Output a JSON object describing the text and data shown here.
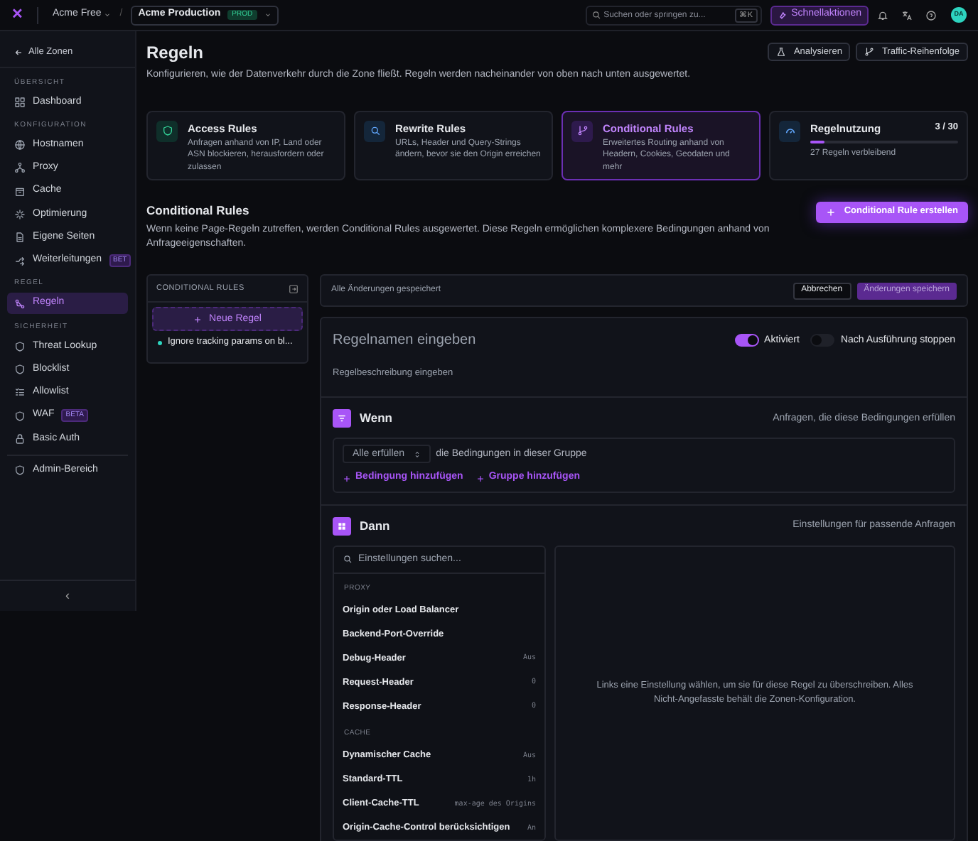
{
  "topbar": {
    "logo": "✕",
    "account": "Acme Free",
    "separator": "/",
    "zone": "Acme Production",
    "zone_badge": "PROD",
    "search": {
      "placeholder": "Suchen oder springen zu..."
    },
    "shortcut": "⌘K",
    "quick_actions": "Schnellaktionen",
    "avatar": "DA"
  },
  "sidebar": {
    "back": "Alle Zonen",
    "sections": [
      {
        "title": "ÜBERSICHT",
        "items": [
          {
            "label": "Dashboard",
            "selected": false
          }
        ]
      },
      {
        "title": "KONFIGURATION",
        "items": [
          {
            "label": "Hostnamen",
            "selected": false
          },
          {
            "label": "Proxy",
            "selected": false
          },
          {
            "label": "Cache",
            "selected": false
          },
          {
            "label": "Optimierung",
            "selected": false
          },
          {
            "label": "Eigene Seiten",
            "selected": false
          },
          {
            "label": "Weiterleitungen",
            "badge": "BET",
            "selected": false
          }
        ]
      },
      {
        "title": "REGEL",
        "items": [
          {
            "label": "Regeln",
            "selected": true
          }
        ]
      },
      {
        "title": "SICHERHEIT",
        "items": [
          {
            "label": "Threat Lookup",
            "selected": false
          },
          {
            "label": "Blocklist",
            "selected": false
          },
          {
            "label": "Allowlist",
            "selected": false
          },
          {
            "label": "WAF",
            "badge": "BETA",
            "selected": false
          },
          {
            "label": "Basic Auth",
            "selected": false
          }
        ]
      }
    ],
    "footer_items": [
      {
        "label": "Admin-Bereich",
        "selected": false
      }
    ],
    "collapse": "‹"
  },
  "page": {
    "title": "Regeln",
    "subtitle": "Konfigurieren, wie der Datenverkehr durch die Zone fließt. Regeln werden nacheinander von oben nach unten ausgewertet.",
    "actions": [
      {
        "label": "Analysieren"
      },
      {
        "label": "Traffic-Reihenfolge"
      }
    ]
  },
  "rule_types": [
    {
      "title": "Access Rules",
      "description": "Anfragen anhand von IP, Land oder ASN blockieren, herausfordern oder zulassen",
      "selected": false
    },
    {
      "title": "Rewrite Rules",
      "description": "URLs, Header und Query-Strings ändern, bevor sie den Origin erreichen",
      "selected": false
    },
    {
      "title": "Conditional Rules",
      "description": "Erweitertes Routing anhand von Headern, Cookies, Geodaten und mehr",
      "selected": true
    }
  ],
  "usage": {
    "title": "Regelnutzung",
    "count": "3 / 30",
    "level": 0.1,
    "remaining": "27 Regeln verbleibend"
  },
  "section": {
    "title": "Conditional Rules",
    "description": "Wenn keine Page-Regeln zutreffen, werden Conditional Rules ausgewertet. Diese Regeln ermöglichen komplexere Bedingungen anhand von Anfrageeigenschaften.",
    "create_button": "Conditional Rule erstellen"
  },
  "rules_panel": {
    "title": "CONDITIONAL RULES",
    "new_button": "Neue Regel",
    "rules": [
      {
        "label": "Ignore tracking params on bl...",
        "color": "#2dd4bf",
        "selected": false
      }
    ]
  },
  "editor": {
    "status": "Alle Änderungen gespeichert",
    "cancel": "Abbrechen",
    "save": "Änderungen speichern",
    "name": {
      "placeholder": "Regelnamen eingeben"
    },
    "description": {
      "placeholder": "Regelbeschreibung eingeben"
    },
    "toggles": [
      {
        "label": "Aktiviert",
        "on": true
      },
      {
        "label": "Nach Ausführung stoppen",
        "on": false
      }
    ],
    "when": {
      "title": "Wenn",
      "hint": "Anfragen, die diese Bedingungen erfüllen",
      "match": "Alle erfüllen",
      "match_text": "die Bedingungen in dieser Gruppe",
      "add_condition": "Bedingung hinzufügen",
      "add_group": "Gruppe hinzufügen"
    },
    "then": {
      "title": "Dann",
      "hint": "Einstellungen für passende Anfragen",
      "search": {
        "placeholder": "Einstellungen suchen..."
      },
      "groups": [
        {
          "title": "PROXY",
          "items": [
            {
              "label": "Origin oder Load Balancer"
            },
            {
              "label": "Backend-Port-Override"
            },
            {
              "label": "Debug-Header",
              "value": "Aus"
            },
            {
              "label": "Request-Header",
              "value": "0"
            },
            {
              "label": "Response-Header",
              "value": "0"
            }
          ]
        },
        {
          "title": "CACHE",
          "items": [
            {
              "label": "Dynamischer Cache",
              "value": "Aus"
            },
            {
              "label": "Standard-TTL",
              "value": "1h"
            },
            {
              "label": "Client-Cache-TTL",
              "value": "max-age des Origins"
            },
            {
              "label": "Origin-Cache-Control berücksichtigen",
              "value": "An"
            }
          ]
        }
      ],
      "empty": "Links eine Einstellung wählen, um sie für diese Regel zu überschreiben. Alles Nicht-Angefasste behält die Zonen-Konfiguration."
    }
  }
}
